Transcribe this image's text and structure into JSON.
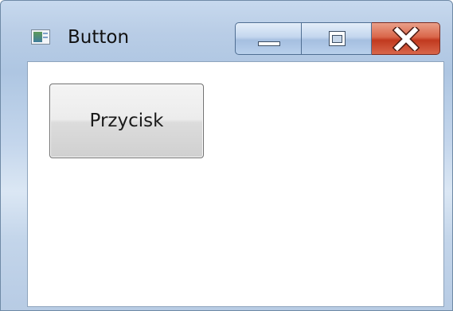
{
  "window": {
    "title": "Button"
  },
  "caption_buttons": {
    "minimize": "minimize-icon",
    "maximize": "maximize-icon",
    "close": "close-icon"
  },
  "content": {
    "button_label": "Przycisk"
  },
  "colors": {
    "close_button": "#c1391f",
    "frame": "#aec6e2"
  }
}
